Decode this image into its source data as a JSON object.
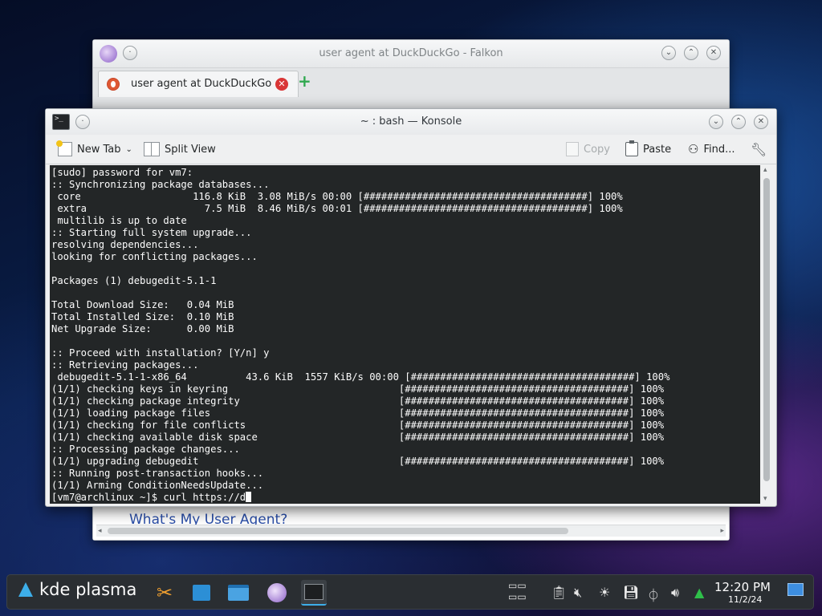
{
  "falkon": {
    "title": "user agent at DuckDuckGo - Falkon",
    "tab_label": "user agent at DuckDuckGo",
    "page_heading": "What's My User Agent?"
  },
  "konsole": {
    "title": "~ : bash — Konsole",
    "toolbar": {
      "new_tab": "New Tab",
      "split_view": "Split View",
      "copy": "Copy",
      "paste": "Paste",
      "find": "Find..."
    },
    "terminal_lines": [
      "[sudo] password for vm7:",
      ":: Synchronizing package databases...",
      " core                   116.8 KiB  3.08 MiB/s 00:00 [######################################] 100%",
      " extra                    7.5 MiB  8.46 MiB/s 00:01 [######################################] 100%",
      " multilib is up to date",
      ":: Starting full system upgrade...",
      "resolving dependencies...",
      "looking for conflicting packages...",
      "",
      "Packages (1) debugedit-5.1-1",
      "",
      "Total Download Size:   0.04 MiB",
      "Total Installed Size:  0.10 MiB",
      "Net Upgrade Size:      0.00 MiB",
      "",
      ":: Proceed with installation? [Y/n] y",
      ":: Retrieving packages...",
      " debugedit-5.1-1-x86_64          43.6 KiB  1557 KiB/s 00:00 [######################################] 100%",
      "(1/1) checking keys in keyring                             [######################################] 100%",
      "(1/1) checking package integrity                           [######################################] 100%",
      "(1/1) loading package files                                [######################################] 100%",
      "(1/1) checking for file conflicts                          [######################################] 100%",
      "(1/1) checking available disk space                        [######################################] 100%",
      ":: Processing package changes...",
      "(1/1) upgrading debugedit                                  [######################################] 100%",
      ":: Running post-transaction hooks...",
      "(1/1) Arming ConditionNeedsUpdate..."
    ],
    "prompt": "[vm7@archlinux ~]$ curl https://d"
  },
  "taskbar": {
    "launcher_label": "kde plasma",
    "time": "12:20 PM",
    "date": "11/2/24"
  },
  "colors": {
    "terminal_bg": "#232627",
    "terminal_fg": "#fcfcfc",
    "accent": "#3daee9",
    "taskbar_bg": "#2a2e32"
  }
}
